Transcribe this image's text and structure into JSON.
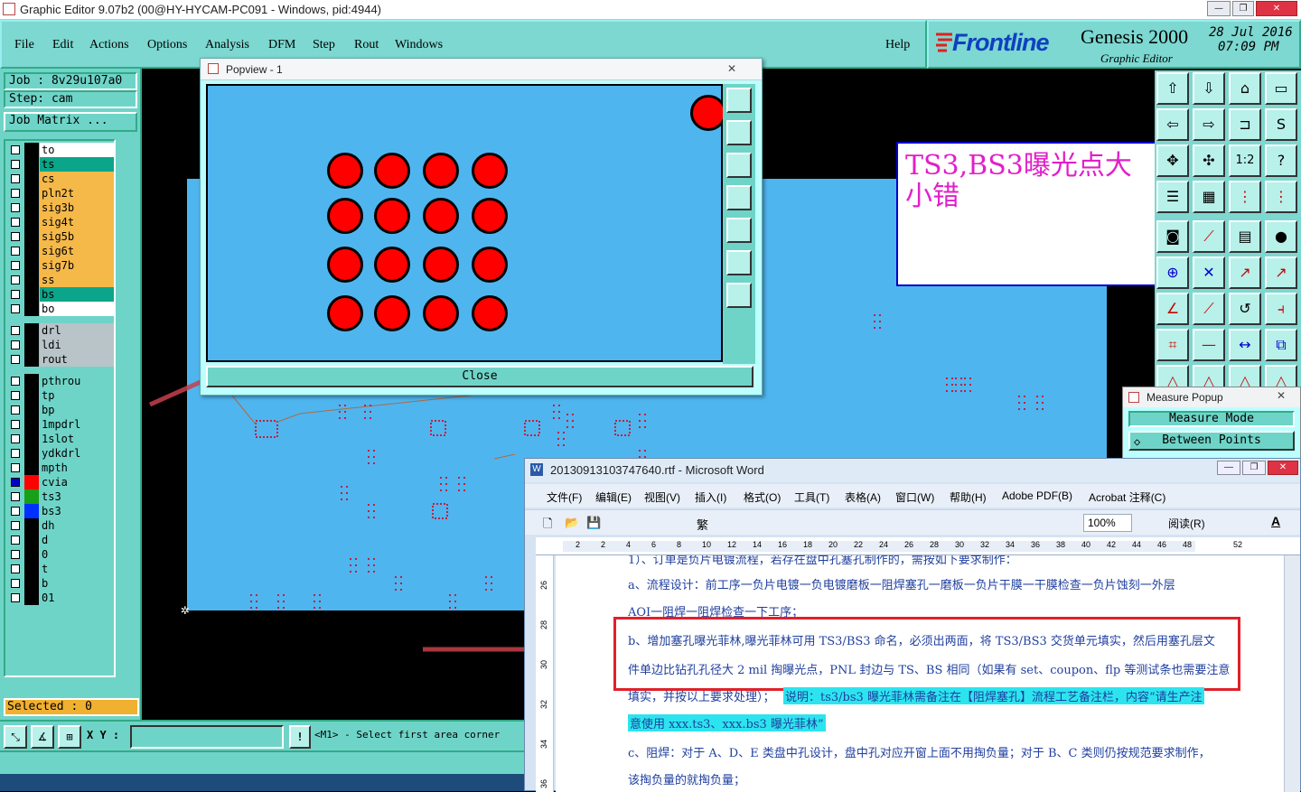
{
  "titlebar": {
    "title": "Graphic Editor 9.07b2 (00@HY-HYCAM-PC091 - Windows, pid:4944)"
  },
  "menu": {
    "items": [
      "File",
      "Edit",
      "Actions",
      "Options",
      "Analysis",
      "DFM",
      "Step",
      "Rout",
      "Windows"
    ],
    "help": "Help"
  },
  "brand": {
    "logo": "Frontline",
    "product": "Genesis 2000",
    "subtitle": "Graphic Editor",
    "date": "28 Jul 2016",
    "time": "07:09 PM"
  },
  "left": {
    "job": "Job  : 8v29u107a0",
    "step": "Step: cam",
    "job_matrix": "Job Matrix ...",
    "layers": [
      {
        "name": "to",
        "color": "#ffffff",
        "swatch": "#000000"
      },
      {
        "name": "ts",
        "color": "#0ba58a",
        "swatch": "#000000"
      },
      {
        "name": "cs",
        "color": "#f5b94a",
        "swatch": "#000000"
      },
      {
        "name": "pln2t",
        "color": "#f5b94a",
        "swatch": "#000000"
      },
      {
        "name": "sig3b",
        "color": "#f5b94a",
        "swatch": "#000000"
      },
      {
        "name": "sig4t",
        "color": "#f5b94a",
        "swatch": "#000000"
      },
      {
        "name": "sig5b",
        "color": "#f5b94a",
        "swatch": "#000000"
      },
      {
        "name": "sig6t",
        "color": "#f5b94a",
        "swatch": "#000000"
      },
      {
        "name": "sig7b",
        "color": "#f5b94a",
        "swatch": "#000000"
      },
      {
        "name": "ss",
        "color": "#f5b94a",
        "swatch": "#000000"
      },
      {
        "name": "bs",
        "color": "#0ba58a",
        "swatch": "#000000"
      },
      {
        "name": "bo",
        "color": "#ffffff",
        "swatch": "#000000"
      },
      {
        "name": "drl",
        "color": "#b8c4c8",
        "swatch": "#000000"
      },
      {
        "name": "ldi",
        "color": "#b8c4c8",
        "swatch": "#000000"
      },
      {
        "name": "rout",
        "color": "#b8c4c8",
        "swatch": "#000000"
      },
      {
        "name": "pthrou",
        "color": "#6fd4c8",
        "swatch": "#000000"
      },
      {
        "name": "tp",
        "color": "#6fd4c8",
        "swatch": "#000000"
      },
      {
        "name": "bp",
        "color": "#6fd4c8",
        "swatch": "#000000"
      },
      {
        "name": "1mpdrl",
        "color": "#6fd4c8",
        "swatch": "#000000"
      },
      {
        "name": "1slot",
        "color": "#6fd4c8",
        "swatch": "#000000"
      },
      {
        "name": "ydkdrl",
        "color": "#6fd4c8",
        "swatch": "#000000"
      },
      {
        "name": "mpth",
        "color": "#6fd4c8",
        "swatch": "#000000"
      },
      {
        "name": "cvia",
        "color": "#6fd4c8",
        "swatch": "#ff0000",
        "checked": true
      },
      {
        "name": "ts3",
        "color": "#6fd4c8",
        "swatch": "#18a018"
      },
      {
        "name": "bs3",
        "color": "#6fd4c8",
        "swatch": "#0030ff"
      },
      {
        "name": "dh",
        "color": "#6fd4c8",
        "swatch": "#000000"
      },
      {
        "name": "d",
        "color": "#6fd4c8",
        "swatch": "#000000"
      },
      {
        "name": "0",
        "color": "#6fd4c8",
        "swatch": "#000000"
      },
      {
        "name": "t",
        "color": "#6fd4c8",
        "swatch": "#000000"
      },
      {
        "name": "b",
        "color": "#6fd4c8",
        "swatch": "#000000"
      },
      {
        "name": "01",
        "color": "#6fd4c8",
        "swatch": "#000000"
      }
    ],
    "selected": "Selected : 0"
  },
  "popview": {
    "title": "Popview - 1",
    "close_label": "Close"
  },
  "annotation": "TS3,BS3曝光点大小错",
  "measure": {
    "title": "Measure Popup",
    "mode": "Measure Mode",
    "option": "Between Points"
  },
  "bottom": {
    "xy_label": "X Y :",
    "hint": "<M1> - Select first area corner"
  },
  "word": {
    "title": "20130913103747640.rtf - Microsoft Word",
    "menu": [
      "文件(F)",
      "编辑(E)",
      "视图(V)",
      "插入(I)",
      "格式(O)",
      "工具(T)",
      "表格(A)",
      "窗口(W)",
      "帮助(H)",
      "Adobe PDF(B)",
      "Acrobat 注释(C)"
    ],
    "zoom": "100%",
    "read": "阅读(R)",
    "ruler": [
      "2",
      "2",
      "4",
      "6",
      "8",
      "10",
      "12",
      "14",
      "16",
      "18",
      "20",
      "22",
      "24",
      "26",
      "28",
      "30",
      "32",
      "34",
      "36",
      "38",
      "40",
      "42",
      "44",
      "46",
      "48",
      "",
      "52"
    ],
    "lines": [
      "1）、订单是负片电镀流程，若存在盘中孔塞孔制作的，需按如下要求制作：",
      "a、流程设计：前工序一负片电镀一负电镀磨板一阻焊塞孔一磨板一负片干膜一干膜检查一负片蚀刻一外层",
      "AOI一阻焊一阻焊检查一下工序；",
      "b、增加塞孔曝光菲林,曝光菲林可用 TS3/BS3 命名，必须出两面，将 TS3/BS3 交货单元填实，然后用塞孔层文",
      "件单边比钻孔孔径大 2 mil 掏曝光点，PNL 封边与 TS、BS 相同（如果有 set、coupon、flp 等测试条也需要注意",
      "填实，并按以上要求处理）；",
      "说明：ts3/bs3 曝光菲林需备注在【阻焊塞孔】流程工艺备注栏，内容“请生产注",
      "意使用 xxx.ts3、xxx.bs3 曝光菲林”",
      "c、阻焊：对于 A、D、E 类盘中孔设计，盘中孔对应开窗上面不用掏负量；对于 B、C 类则仍按规范要求制作，",
      "该掏负量的就掏负量；"
    ],
    "line_numbers": [
      "26",
      "28",
      "30",
      "32",
      "34",
      "36"
    ]
  },
  "colors": {
    "accent": "#7cd8d0",
    "board": "#4fb5ef",
    "pad": "#ff0000",
    "highlight_box": "#e0202a",
    "annotation_text": "#e020c8"
  }
}
